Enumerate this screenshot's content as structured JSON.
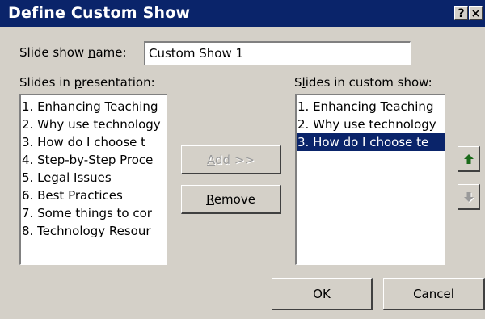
{
  "window": {
    "title": "Define Custom Show",
    "help_label": "?",
    "close_label": "×"
  },
  "name_field": {
    "label_pre": "Slide show ",
    "label_hotkey": "n",
    "label_post": "ame:",
    "value": "Custom Show 1"
  },
  "presentation_list": {
    "label_pre": "Slides in ",
    "label_hotkey": "p",
    "label_post": "resentation:",
    "items": [
      "1. Enhancing Teaching",
      "2. Why use technology",
      "3.  How do I choose t",
      "4. Step-by-Step Proce",
      "5. Legal Issues",
      "6. Best Practices",
      "7. Some things to cor",
      "8. Technology Resour"
    ]
  },
  "custom_list": {
    "label_pre": "S",
    "label_hotkey": "l",
    "label_post": "ides in custom show:",
    "items": [
      "1. Enhancing Teaching",
      "2. Why use technology",
      "3.  How do I choose te"
    ],
    "selected_index": 2
  },
  "buttons": {
    "add_hotkey": "A",
    "add_rest": "dd >>",
    "remove_hotkey": "R",
    "remove_rest": "emove",
    "ok": "OK",
    "cancel": "Cancel"
  },
  "icons": {
    "move_up": "arrow-up-icon",
    "move_down": "arrow-down-icon"
  },
  "colors": {
    "titlebar": "#0a246a",
    "dialog": "#d4d0c8",
    "selection": "#0a246a",
    "up_arrow": "#1a6a1a",
    "down_arrow_disabled": "#9a9a9a"
  }
}
